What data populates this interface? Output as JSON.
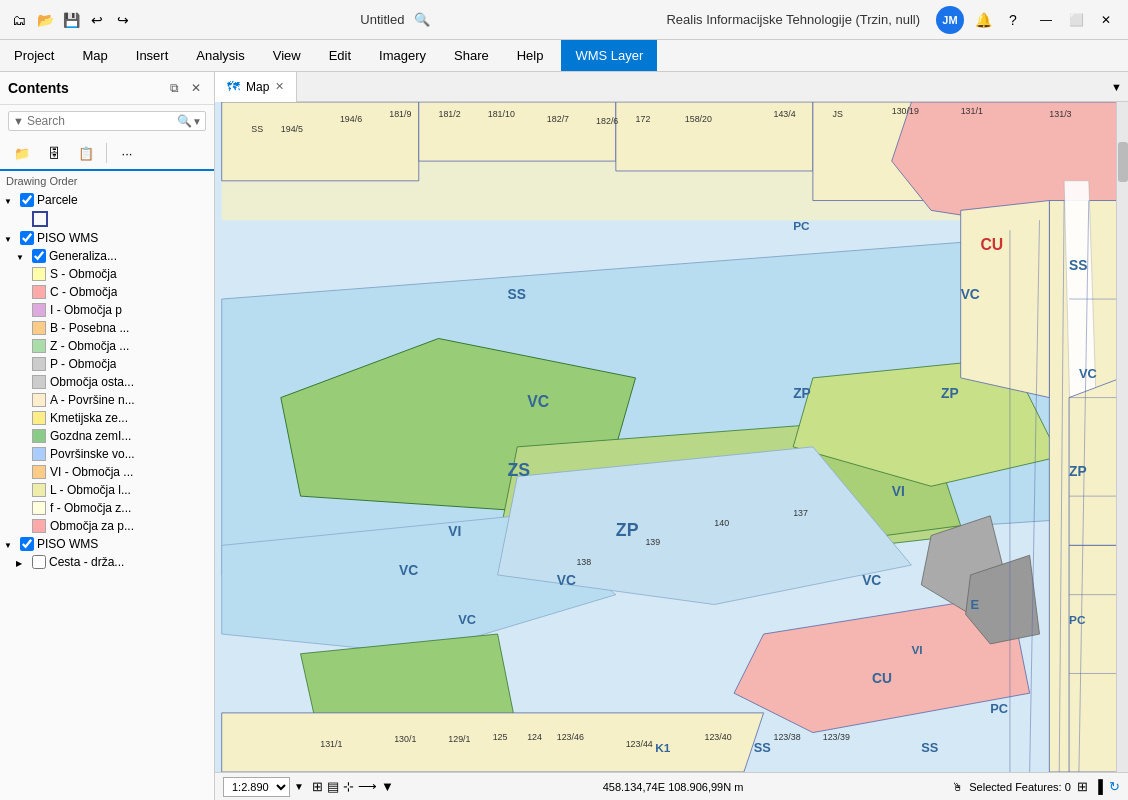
{
  "titlebar": {
    "title": "Untitled",
    "app_name": "Realis Informacijske Tehnologije (Trzin, null)",
    "user_initials": "JM",
    "search_placeholder": "Search"
  },
  "menubar": {
    "items": [
      "Project",
      "Map",
      "Insert",
      "Analysis",
      "View",
      "Edit",
      "Imagery",
      "Share",
      "Help",
      "WMS Layer"
    ]
  },
  "sidebar": {
    "title": "Contents",
    "search_placeholder": "Search",
    "layers": [
      {
        "id": "parcele",
        "label": "Parcele",
        "checked": true,
        "indent": 1,
        "type": "group",
        "expanded": true
      },
      {
        "id": "parcele-sub",
        "label": "",
        "checked": false,
        "indent": 2,
        "type": "feature",
        "color": "#4444aa",
        "swatch": "square"
      },
      {
        "id": "piso-wms1",
        "label": "PISO WMS",
        "checked": true,
        "indent": 0,
        "type": "group",
        "expanded": true
      },
      {
        "id": "generaliz",
        "label": "Generaliza...",
        "checked": true,
        "indent": 1,
        "type": "group",
        "expanded": true
      },
      {
        "id": "s-obmocja",
        "label": "S - Območja",
        "checked": true,
        "indent": 2,
        "color": "#ffffaa",
        "type": "swatch"
      },
      {
        "id": "c-obmocja",
        "label": "C - Območja",
        "checked": true,
        "indent": 2,
        "color": "#ffaaaa",
        "type": "swatch"
      },
      {
        "id": "i-obmocja",
        "label": "I - Območja p",
        "checked": true,
        "indent": 2,
        "color": "#ddaadd",
        "type": "swatch"
      },
      {
        "id": "b-posebna",
        "label": "B - Posebna ...",
        "checked": true,
        "indent": 2,
        "color": "#ffcc88",
        "type": "swatch"
      },
      {
        "id": "z-obmocja",
        "label": "Z - Območja ...",
        "checked": true,
        "indent": 2,
        "color": "#aaddaa",
        "type": "swatch"
      },
      {
        "id": "p-obmocja",
        "label": "P - Območja",
        "checked": false,
        "indent": 2,
        "color": "#cccccc",
        "type": "swatch"
      },
      {
        "id": "obmocja-osta",
        "label": "Območja osta...",
        "checked": false,
        "indent": 2,
        "color": "#cccccc",
        "type": "swatch"
      },
      {
        "id": "a-povrsine",
        "label": "A - Površine n...",
        "checked": false,
        "indent": 2,
        "color": "#ffeecc",
        "type": "swatch"
      },
      {
        "id": "kmetijska",
        "label": "Kmetijska ze...",
        "checked": false,
        "indent": 2,
        "color": "#ffee88",
        "type": "swatch"
      },
      {
        "id": "gozdna",
        "label": "Gozdna zemI...",
        "checked": false,
        "indent": 2,
        "color": "#88cc88",
        "type": "swatch"
      },
      {
        "id": "povrsinske",
        "label": "Površinske vo...",
        "checked": false,
        "indent": 2,
        "color": "#aaccff",
        "type": "swatch"
      },
      {
        "id": "vi-obmocja",
        "label": "VI - Območja ...",
        "checked": false,
        "indent": 2,
        "color": "#ffcc88",
        "type": "swatch"
      },
      {
        "id": "l-obmocja",
        "label": "L - Območja l...",
        "checked": false,
        "indent": 2,
        "color": "#eeeeaa",
        "type": "swatch"
      },
      {
        "id": "f-obmocja",
        "label": "f - Območja z...",
        "checked": false,
        "indent": 2,
        "color": "#ffffdd",
        "type": "swatch"
      },
      {
        "id": "obmocja-p",
        "label": "Območja za p...",
        "checked": false,
        "indent": 2,
        "color": "#ffaaaa",
        "type": "swatch"
      },
      {
        "id": "piso-wms2",
        "label": "PISO WMS",
        "checked": true,
        "indent": 0,
        "type": "group",
        "expanded": false
      },
      {
        "id": "cesta-drz",
        "label": "Cesta - drža...",
        "checked": false,
        "indent": 1,
        "type": "feature"
      }
    ]
  },
  "map": {
    "tab_label": "Map",
    "zoom_level": "1:2.890",
    "coords": "458.134,74E 108.906,99N m",
    "selected_features": "Selected Features: 0"
  },
  "statusbar": {
    "scale": "1:2.890",
    "coords": "458.134,74E 108.906,99N m",
    "selected_features": "Selected Features: 0"
  }
}
